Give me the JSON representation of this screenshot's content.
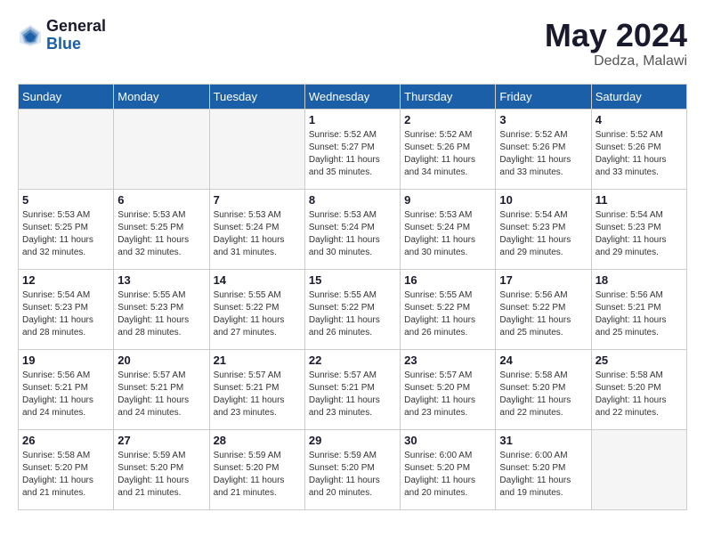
{
  "logo": {
    "general": "General",
    "blue": "Blue"
  },
  "title": {
    "month_year": "May 2024",
    "location": "Dedza, Malawi"
  },
  "weekdays": [
    "Sunday",
    "Monday",
    "Tuesday",
    "Wednesday",
    "Thursday",
    "Friday",
    "Saturday"
  ],
  "weeks": [
    [
      {
        "day": "",
        "sunrise": "",
        "sunset": "",
        "daylight": ""
      },
      {
        "day": "",
        "sunrise": "",
        "sunset": "",
        "daylight": ""
      },
      {
        "day": "",
        "sunrise": "",
        "sunset": "",
        "daylight": ""
      },
      {
        "day": "1",
        "sunrise": "Sunrise: 5:52 AM",
        "sunset": "Sunset: 5:27 PM",
        "daylight": "Daylight: 11 hours and 35 minutes."
      },
      {
        "day": "2",
        "sunrise": "Sunrise: 5:52 AM",
        "sunset": "Sunset: 5:26 PM",
        "daylight": "Daylight: 11 hours and 34 minutes."
      },
      {
        "day": "3",
        "sunrise": "Sunrise: 5:52 AM",
        "sunset": "Sunset: 5:26 PM",
        "daylight": "Daylight: 11 hours and 33 minutes."
      },
      {
        "day": "4",
        "sunrise": "Sunrise: 5:52 AM",
        "sunset": "Sunset: 5:26 PM",
        "daylight": "Daylight: 11 hours and 33 minutes."
      }
    ],
    [
      {
        "day": "5",
        "sunrise": "Sunrise: 5:53 AM",
        "sunset": "Sunset: 5:25 PM",
        "daylight": "Daylight: 11 hours and 32 minutes."
      },
      {
        "day": "6",
        "sunrise": "Sunrise: 5:53 AM",
        "sunset": "Sunset: 5:25 PM",
        "daylight": "Daylight: 11 hours and 32 minutes."
      },
      {
        "day": "7",
        "sunrise": "Sunrise: 5:53 AM",
        "sunset": "Sunset: 5:24 PM",
        "daylight": "Daylight: 11 hours and 31 minutes."
      },
      {
        "day": "8",
        "sunrise": "Sunrise: 5:53 AM",
        "sunset": "Sunset: 5:24 PM",
        "daylight": "Daylight: 11 hours and 30 minutes."
      },
      {
        "day": "9",
        "sunrise": "Sunrise: 5:53 AM",
        "sunset": "Sunset: 5:24 PM",
        "daylight": "Daylight: 11 hours and 30 minutes."
      },
      {
        "day": "10",
        "sunrise": "Sunrise: 5:54 AM",
        "sunset": "Sunset: 5:23 PM",
        "daylight": "Daylight: 11 hours and 29 minutes."
      },
      {
        "day": "11",
        "sunrise": "Sunrise: 5:54 AM",
        "sunset": "Sunset: 5:23 PM",
        "daylight": "Daylight: 11 hours and 29 minutes."
      }
    ],
    [
      {
        "day": "12",
        "sunrise": "Sunrise: 5:54 AM",
        "sunset": "Sunset: 5:23 PM",
        "daylight": "Daylight: 11 hours and 28 minutes."
      },
      {
        "day": "13",
        "sunrise": "Sunrise: 5:55 AM",
        "sunset": "Sunset: 5:23 PM",
        "daylight": "Daylight: 11 hours and 28 minutes."
      },
      {
        "day": "14",
        "sunrise": "Sunrise: 5:55 AM",
        "sunset": "Sunset: 5:22 PM",
        "daylight": "Daylight: 11 hours and 27 minutes."
      },
      {
        "day": "15",
        "sunrise": "Sunrise: 5:55 AM",
        "sunset": "Sunset: 5:22 PM",
        "daylight": "Daylight: 11 hours and 26 minutes."
      },
      {
        "day": "16",
        "sunrise": "Sunrise: 5:55 AM",
        "sunset": "Sunset: 5:22 PM",
        "daylight": "Daylight: 11 hours and 26 minutes."
      },
      {
        "day": "17",
        "sunrise": "Sunrise: 5:56 AM",
        "sunset": "Sunset: 5:22 PM",
        "daylight": "Daylight: 11 hours and 25 minutes."
      },
      {
        "day": "18",
        "sunrise": "Sunrise: 5:56 AM",
        "sunset": "Sunset: 5:21 PM",
        "daylight": "Daylight: 11 hours and 25 minutes."
      }
    ],
    [
      {
        "day": "19",
        "sunrise": "Sunrise: 5:56 AM",
        "sunset": "Sunset: 5:21 PM",
        "daylight": "Daylight: 11 hours and 24 minutes."
      },
      {
        "day": "20",
        "sunrise": "Sunrise: 5:57 AM",
        "sunset": "Sunset: 5:21 PM",
        "daylight": "Daylight: 11 hours and 24 minutes."
      },
      {
        "day": "21",
        "sunrise": "Sunrise: 5:57 AM",
        "sunset": "Sunset: 5:21 PM",
        "daylight": "Daylight: 11 hours and 23 minutes."
      },
      {
        "day": "22",
        "sunrise": "Sunrise: 5:57 AM",
        "sunset": "Sunset: 5:21 PM",
        "daylight": "Daylight: 11 hours and 23 minutes."
      },
      {
        "day": "23",
        "sunrise": "Sunrise: 5:57 AM",
        "sunset": "Sunset: 5:20 PM",
        "daylight": "Daylight: 11 hours and 23 minutes."
      },
      {
        "day": "24",
        "sunrise": "Sunrise: 5:58 AM",
        "sunset": "Sunset: 5:20 PM",
        "daylight": "Daylight: 11 hours and 22 minutes."
      },
      {
        "day": "25",
        "sunrise": "Sunrise: 5:58 AM",
        "sunset": "Sunset: 5:20 PM",
        "daylight": "Daylight: 11 hours and 22 minutes."
      }
    ],
    [
      {
        "day": "26",
        "sunrise": "Sunrise: 5:58 AM",
        "sunset": "Sunset: 5:20 PM",
        "daylight": "Daylight: 11 hours and 21 minutes."
      },
      {
        "day": "27",
        "sunrise": "Sunrise: 5:59 AM",
        "sunset": "Sunset: 5:20 PM",
        "daylight": "Daylight: 11 hours and 21 minutes."
      },
      {
        "day": "28",
        "sunrise": "Sunrise: 5:59 AM",
        "sunset": "Sunset: 5:20 PM",
        "daylight": "Daylight: 11 hours and 21 minutes."
      },
      {
        "day": "29",
        "sunrise": "Sunrise: 5:59 AM",
        "sunset": "Sunset: 5:20 PM",
        "daylight": "Daylight: 11 hours and 20 minutes."
      },
      {
        "day": "30",
        "sunrise": "Sunrise: 6:00 AM",
        "sunset": "Sunset: 5:20 PM",
        "daylight": "Daylight: 11 hours and 20 minutes."
      },
      {
        "day": "31",
        "sunrise": "Sunrise: 6:00 AM",
        "sunset": "Sunset: 5:20 PM",
        "daylight": "Daylight: 11 hours and 19 minutes."
      },
      {
        "day": "",
        "sunrise": "",
        "sunset": "",
        "daylight": ""
      }
    ]
  ]
}
